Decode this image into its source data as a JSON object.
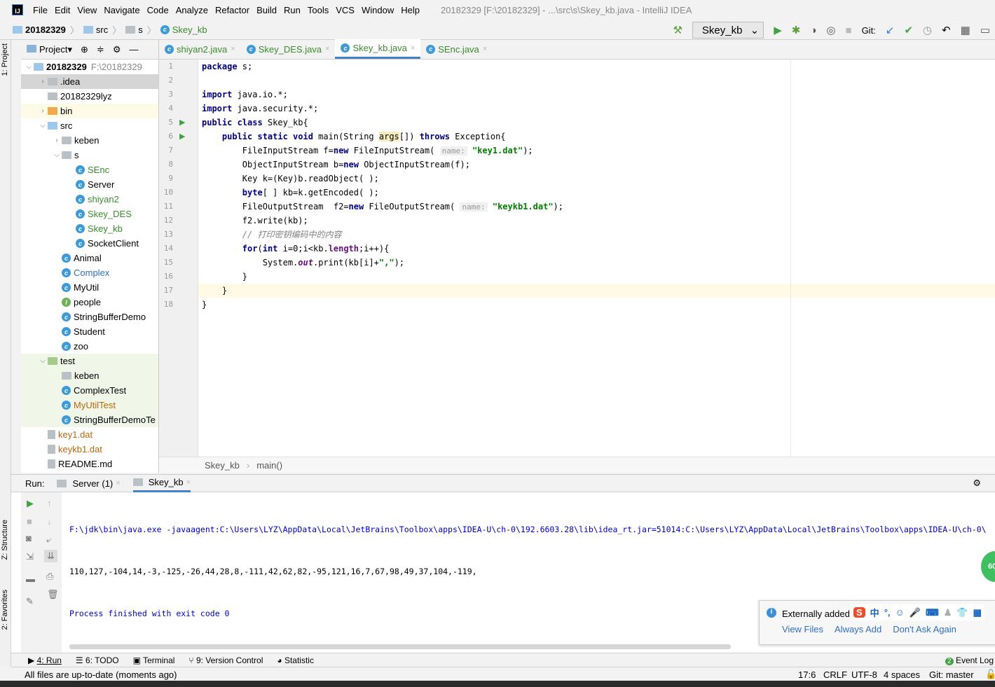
{
  "menu": {
    "items": [
      "File",
      "Edit",
      "View",
      "Navigate",
      "Code",
      "Analyze",
      "Refactor",
      "Build",
      "Run",
      "Tools",
      "VCS",
      "Window",
      "Help"
    ],
    "title": "20182329 [F:\\20182329] - ...\\src\\s\\Skey_kb.java - IntelliJ IDEA"
  },
  "nav": {
    "crumbs": [
      "20182329",
      "src",
      "s",
      "Skey_kb"
    ],
    "run_config": "Skey_kb",
    "git_label": "Git:"
  },
  "sidebar_labels": {
    "project": "1: Project",
    "structure": "Z: Structure",
    "favorites": "2: Favorites"
  },
  "project": {
    "header": "Project",
    "tree": [
      {
        "label": "20182329",
        "suffix": "F:\\20182329",
        "level": 0,
        "arrow": "down",
        "icon": "folder",
        "bold": true
      },
      {
        "label": ".idea",
        "level": 1,
        "arrow": "right",
        "icon": "folder-gray",
        "bg": "#d5d5d5"
      },
      {
        "label": "20182329lyz",
        "level": 1,
        "arrow": "",
        "icon": "folder-gray"
      },
      {
        "label": "bin",
        "level": 1,
        "arrow": "right",
        "icon": "folder-orange",
        "bg": "#fdfbe6"
      },
      {
        "label": "src",
        "level": 1,
        "arrow": "down",
        "icon": "folder"
      },
      {
        "label": "keben",
        "level": 2,
        "arrow": "right",
        "icon": "folder-gray"
      },
      {
        "label": "s",
        "level": 2,
        "arrow": "down",
        "icon": "folder-gray"
      },
      {
        "label": "SEnc",
        "level": 3,
        "icon": "class",
        "color": "#3b8a2e"
      },
      {
        "label": "Server",
        "level": 3,
        "icon": "class"
      },
      {
        "label": "shiyan2",
        "level": 3,
        "icon": "class",
        "color": "#3b8a2e"
      },
      {
        "label": "Skey_DES",
        "level": 3,
        "icon": "class",
        "color": "#3b8a2e"
      },
      {
        "label": "Skey_kb",
        "level": 3,
        "icon": "class",
        "color": "#3b8a2e"
      },
      {
        "label": "SocketClient",
        "level": 3,
        "icon": "class"
      },
      {
        "label": "Animal",
        "level": 2,
        "icon": "class"
      },
      {
        "label": "Complex",
        "level": 2,
        "icon": "class",
        "color": "#2f6fbf"
      },
      {
        "label": "MyUtil",
        "level": 2,
        "icon": "class"
      },
      {
        "label": "people",
        "level": 2,
        "icon": "interface"
      },
      {
        "label": "StringBufferDemo",
        "level": 2,
        "icon": "class"
      },
      {
        "label": "Student",
        "level": 2,
        "icon": "class"
      },
      {
        "label": "zoo",
        "level": 2,
        "icon": "class"
      },
      {
        "label": "test",
        "level": 1,
        "arrow": "down",
        "icon": "folder-green",
        "bg": "#f0f7e8"
      },
      {
        "label": "keben",
        "level": 2,
        "icon": "folder-gray",
        "bg": "#f0f7e8"
      },
      {
        "label": "ComplexTest",
        "level": 2,
        "icon": "class",
        "bg": "#f0f7e8"
      },
      {
        "label": "MyUtilTest",
        "level": 2,
        "icon": "class",
        "color": "#b8660e",
        "bg": "#f0f7e8"
      },
      {
        "label": "StringBufferDemoTe",
        "level": 2,
        "icon": "class",
        "bg": "#f0f7e8"
      },
      {
        "label": "key1.dat",
        "level": 1,
        "icon": "file",
        "color": "#b8660e"
      },
      {
        "label": "keykb1.dat",
        "level": 1,
        "icon": "file",
        "color": "#b8660e"
      },
      {
        "label": "README.md",
        "level": 1,
        "icon": "md-file"
      }
    ]
  },
  "editor": {
    "tabs": [
      {
        "label": "shiyan2.java"
      },
      {
        "label": "Skey_DES.java"
      },
      {
        "label": "Skey_kb.java",
        "active": true
      },
      {
        "label": "SEnc.java"
      }
    ],
    "lines": [
      [
        [
          "package",
          "kw"
        ],
        [
          " s;",
          ""
        ]
      ],
      [],
      [
        [
          "import",
          "kw"
        ],
        [
          " java.io.*;",
          ""
        ]
      ],
      [
        [
          "import",
          "kw"
        ],
        [
          " java.security.*;",
          ""
        ]
      ],
      [
        [
          "public class",
          "kw"
        ],
        [
          " Skey_kb{",
          ""
        ]
      ],
      [
        [
          "    "
        ],
        [
          "public static void",
          "kw"
        ],
        [
          " main(String ",
          ""
        ],
        [
          "args",
          "hl"
        ],
        [
          "[]) ",
          ""
        ],
        [
          "throws",
          "kw"
        ],
        [
          " Exception{",
          ""
        ]
      ],
      [
        [
          "        FileInputStream f="
        ],
        [
          "new",
          "kw"
        ],
        [
          " FileInputStream( ",
          ""
        ],
        [
          "name:",
          "hint"
        ],
        [
          " ",
          ""
        ],
        [
          "\"key1.dat\"",
          "str"
        ],
        [
          ");",
          ""
        ]
      ],
      [
        [
          "        ObjectInputStream b="
        ],
        [
          "new",
          "kw"
        ],
        [
          " ObjectInputStream(f);",
          ""
        ]
      ],
      [
        [
          "        Key k=(Key)b.readObject( );"
        ]
      ],
      [
        [
          "        "
        ],
        [
          "byte",
          "kw"
        ],
        [
          "[ ] kb=k.getEncoded( );",
          ""
        ]
      ],
      [
        [
          "        FileOutputStream  f2="
        ],
        [
          "new",
          "kw"
        ],
        [
          " FileOutputStream( ",
          ""
        ],
        [
          "name:",
          "hint"
        ],
        [
          " ",
          ""
        ],
        [
          "\"keykb1.dat\"",
          "str"
        ],
        [
          ");",
          ""
        ]
      ],
      [
        [
          "        f2.write(kb);"
        ]
      ],
      [
        [
          "        "
        ],
        [
          "// 打印密钥编码中的内容",
          "cm"
        ]
      ],
      [
        [
          "        "
        ],
        [
          "for",
          "kw"
        ],
        [
          "(",
          ""
        ],
        [
          "int",
          "kw"
        ],
        [
          " i=0;i<kb.",
          ""
        ],
        [
          "length",
          "fld"
        ],
        [
          ";i++){",
          ""
        ]
      ],
      [
        [
          "            System."
        ],
        [
          "out",
          "it"
        ],
        [
          ".print(kb[i]+",
          ""
        ],
        [
          "\",\"",
          "str"
        ],
        [
          ");",
          ""
        ]
      ],
      [
        [
          "        }"
        ]
      ],
      [
        [
          "    }"
        ]
      ],
      [
        [
          "}"
        ]
      ]
    ],
    "breadcrumb": [
      "Skey_kb",
      "main()"
    ]
  },
  "run": {
    "label": "Run:",
    "tabs": [
      {
        "label": "Server (1)"
      },
      {
        "label": "Skey_kb",
        "active": true
      }
    ],
    "output": [
      "F:\\jdk\\bin\\java.exe -javaagent:C:\\Users\\LYZ\\AppData\\Local\\JetBrains\\Toolbox\\apps\\IDEA-U\\ch-0\\192.6603.28\\lib\\idea_rt.jar=51014:C:\\Users\\LYZ\\AppData\\Local\\JetBrains\\Toolbox\\apps\\IDEA-U\\ch-0\\",
      "110,127,-104,14,-3,-125,-26,44,28,8,-111,42,62,82,-95,121,16,7,67,98,49,37,104,-119,",
      "Process finished with exit code 0"
    ]
  },
  "notification": {
    "title": "Externally added",
    "links": [
      "View Files",
      "Always Add",
      "Don't Ask Again"
    ],
    "ime_badge": "60"
  },
  "bottom_toolbar": [
    "4: Run",
    "6: TODO",
    "Terminal",
    "9: Version Control",
    "Statistic"
  ],
  "event_log": {
    "count": "2",
    "label": "Event Log"
  },
  "status": {
    "message": "All files are up-to-date (moments ago)",
    "position": "17:6",
    "line_sep": "CRLF",
    "encoding": "UTF-8",
    "indent": "4 spaces",
    "git": "Git: master"
  }
}
